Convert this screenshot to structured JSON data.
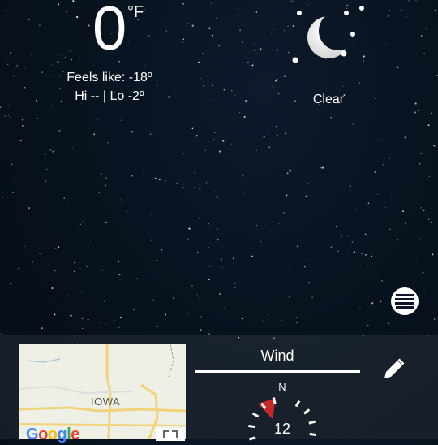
{
  "current": {
    "temperature": "0",
    "unit": "°F",
    "feels_like": "Feels like:  -18º",
    "hi_lo": "Hi  --  |  Lo  -2º",
    "condition": "Clear",
    "condition_icon": "moon-stars-icon"
  },
  "map": {
    "state_label": "IOWA",
    "brand": "Google",
    "expand_icon": "fullscreen-icon"
  },
  "wind": {
    "title": "Wind",
    "north": "N",
    "speed": "12",
    "direction_icon": "wind-direction-arrow-icon",
    "accent": "#c62828"
  },
  "actions": {
    "menu_icon": "list-icon",
    "edit_icon": "pencil-icon"
  }
}
